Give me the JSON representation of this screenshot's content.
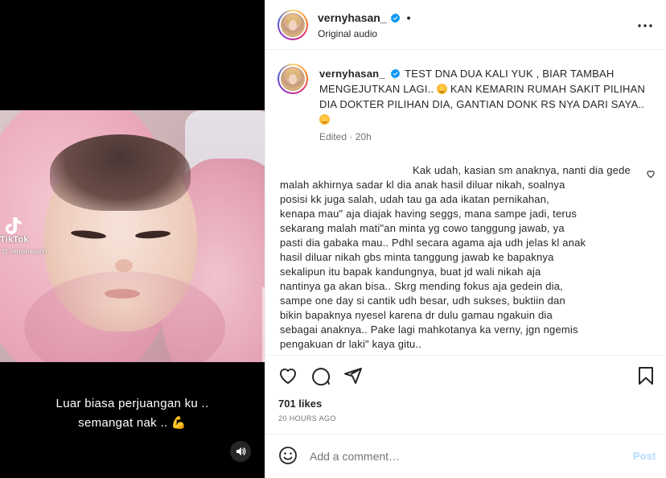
{
  "video": {
    "watermark_brand": "TikTok",
    "watermark_handle": "@ vernyhasann",
    "caption_lines": [
      "Luar biasa perjuangan ku ..",
      "semangat nak .. 💪"
    ],
    "mute_icon": "speaker-icon"
  },
  "header": {
    "username": "vernyhasan_",
    "separator": "•",
    "audio": "Original audio",
    "more_icon": "more-horizontal-icon"
  },
  "post_caption": {
    "username": "vernyhasan_",
    "text_part1": "TEST DNA DUA KALI YUK , BIAR TAMBAH MENGEJUTKAN LAGI..",
    "text_part2": "KAN KEMARIN RUMAH SAKIT PILIHAN DIA DOKTER PILIHAN DIA, GANTIAN DONK RS NYA DARI SAYA..",
    "edited": "Edited",
    "separator": "·",
    "time": "20h"
  },
  "reply": {
    "lines": [
      "Kak udah, kasian sm anaknya, nanti dia gede",
      "malah akhirnya sadar kl dia anak hasil diluar nikah, soalnya",
      "posisi kk juga salah, udah tau ga ada ikatan pernikahan,",
      "kenapa mau\" aja diajak having seggs, mana sampe jadi, terus",
      "sekarang malah mati\"an minta yg cowo tanggung jawab, ya",
      "pasti dia gabaka mau.. Pdhl secara agama aja udh jelas kl anak",
      "hasil diluar nikah gbs minta tanggung jawab ke bapaknya",
      "sekalipun itu bapak kandungnya, buat jd wali nikah aja",
      "nantinya ga akan bisa.. Skrg mending fokus aja gedein dia,",
      "sampe one day si cantik udh besar, udh sukses, buktiin dan",
      "bikin bapaknya nyesel karena dr dulu gamau ngakuin dia",
      "sebagai anaknya.. Pake lagi mahkotanya ka verny, jgn ngemis",
      "pengakuan dr laki\" kaya gitu.."
    ]
  },
  "actions": {
    "likes": "701 likes",
    "time_ago": "20 HOURS AGO"
  },
  "comment_box": {
    "placeholder": "Add a comment…",
    "post_label": "Post"
  }
}
